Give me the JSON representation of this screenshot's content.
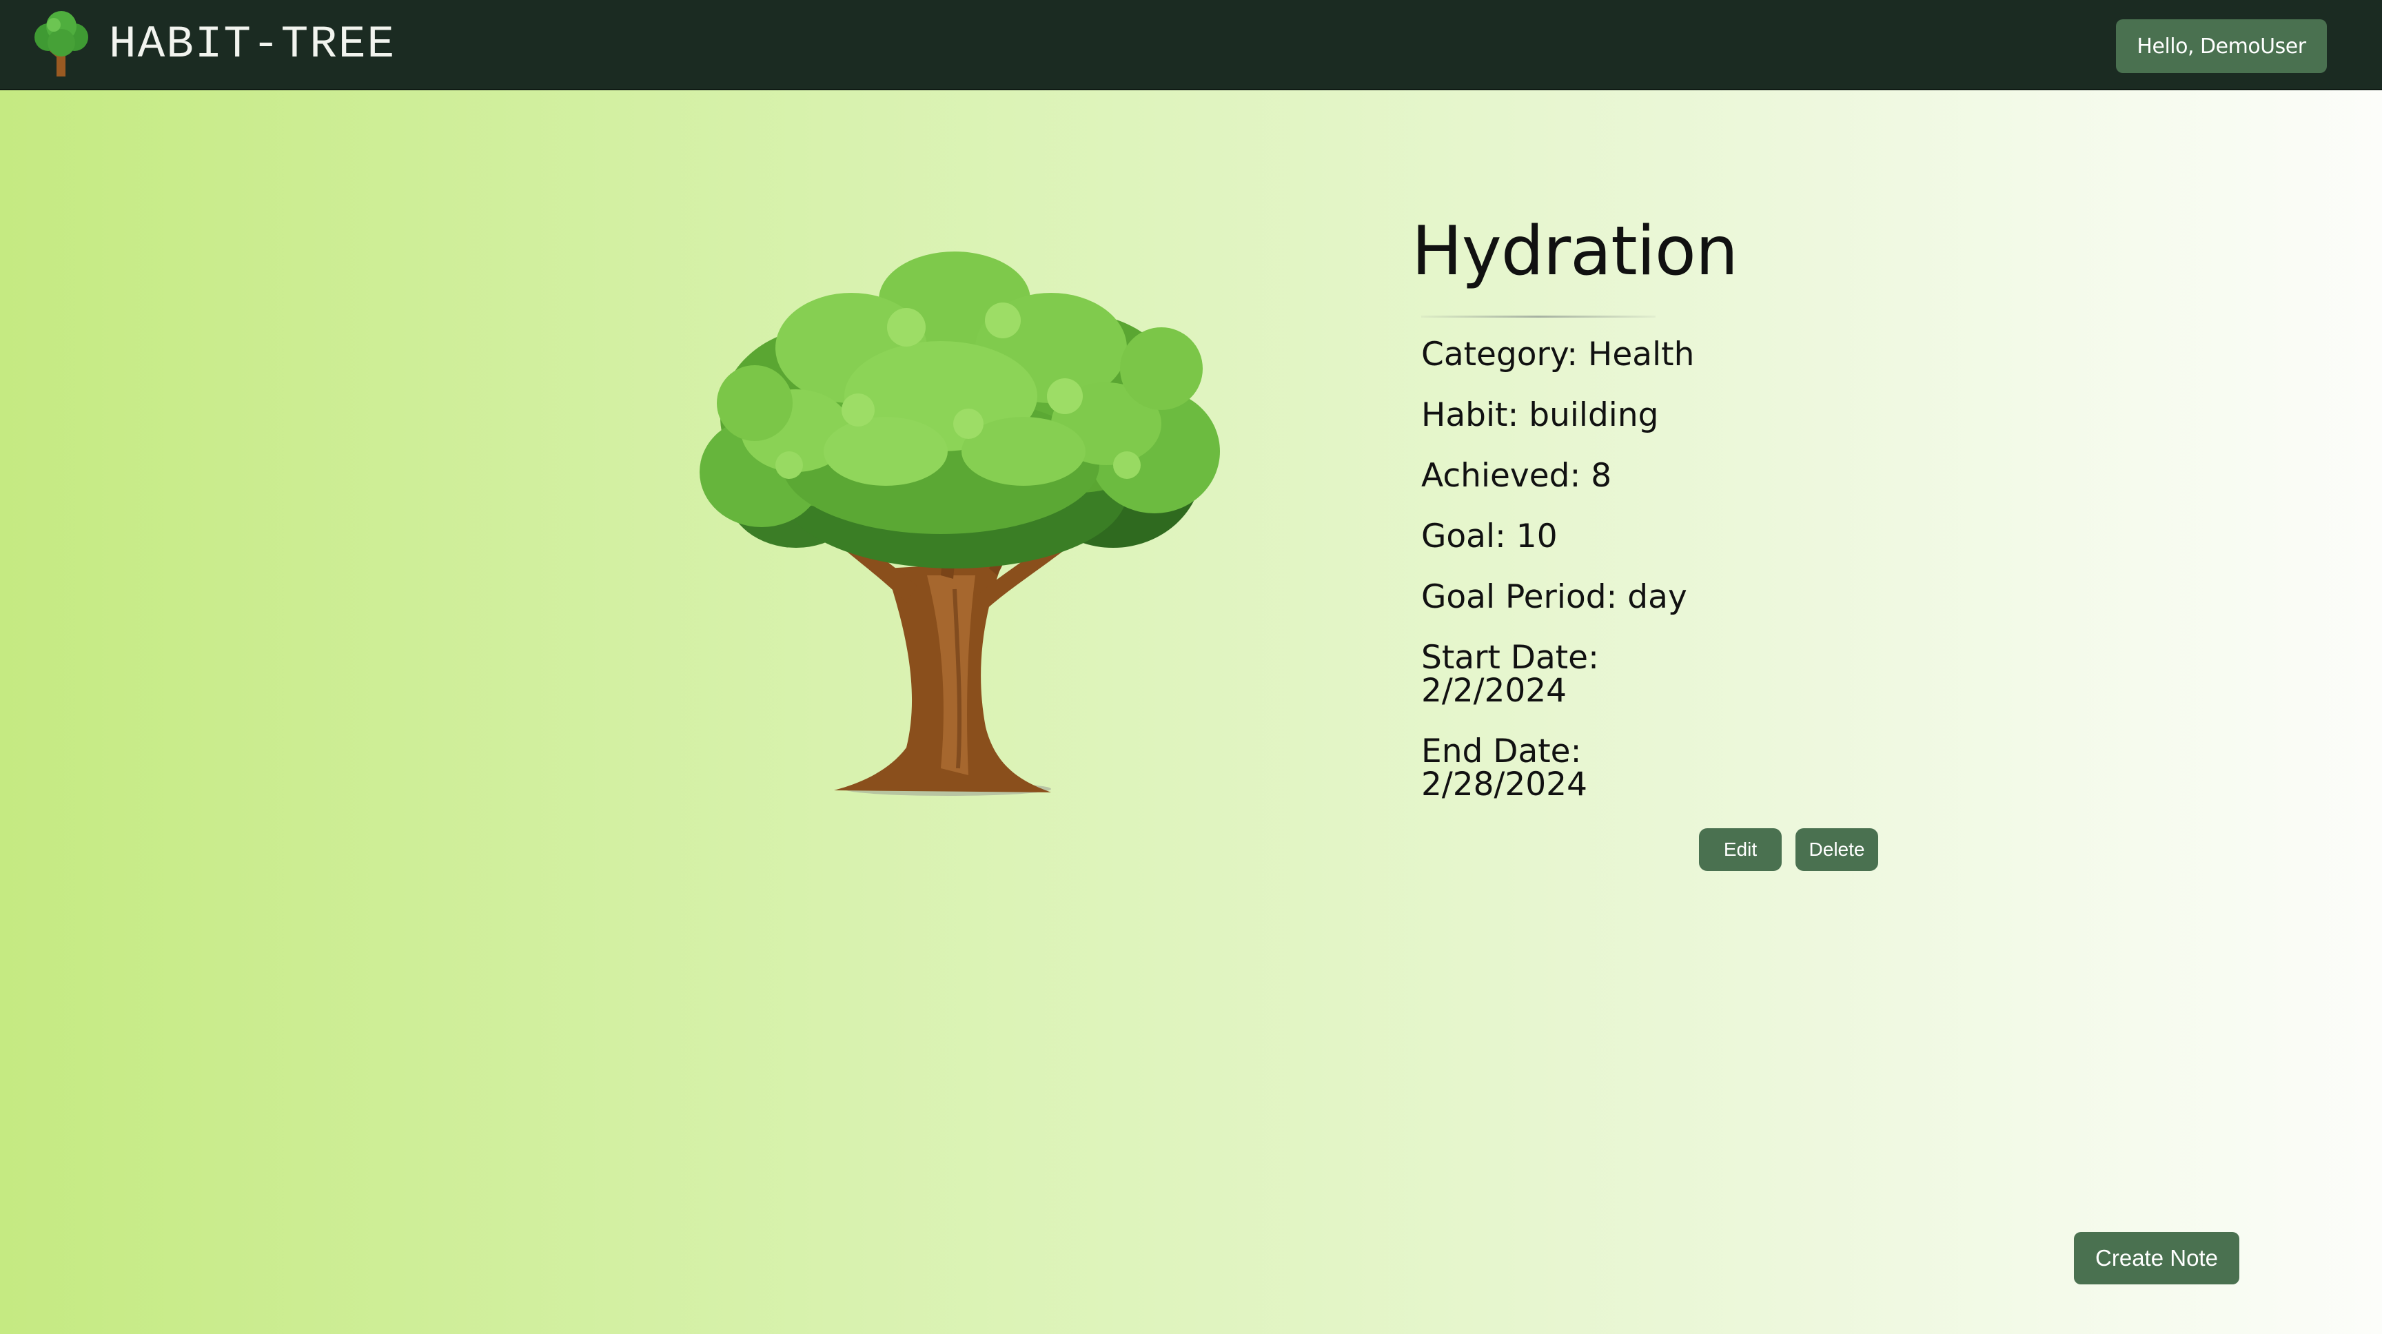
{
  "navbar": {
    "brand": "HABIT-TREE",
    "logo_icon": "tree-logo-icon",
    "user_greeting": "Hello, DemoUser"
  },
  "habit": {
    "title": "Hydration",
    "image_icon": "tree-illustration",
    "category": "Category: Health",
    "habit_type": "Habit: building",
    "achieved": "Achieved: 8",
    "goal": "Goal: 10",
    "goal_period": "Goal Period: day",
    "start_date_label": "Start Date:",
    "start_date_value": "2/2/2024",
    "end_date_label": "End Date:",
    "end_date_value": "2/28/2024"
  },
  "actions": {
    "edit_label": "Edit",
    "delete_label": "Delete",
    "create_note_label": "Create Note"
  },
  "colors": {
    "navbar_bg": "#1b2b22",
    "button_bg": "#4a7150",
    "gradient_start": "#c5ea82",
    "gradient_end": "#fcfdfa"
  }
}
